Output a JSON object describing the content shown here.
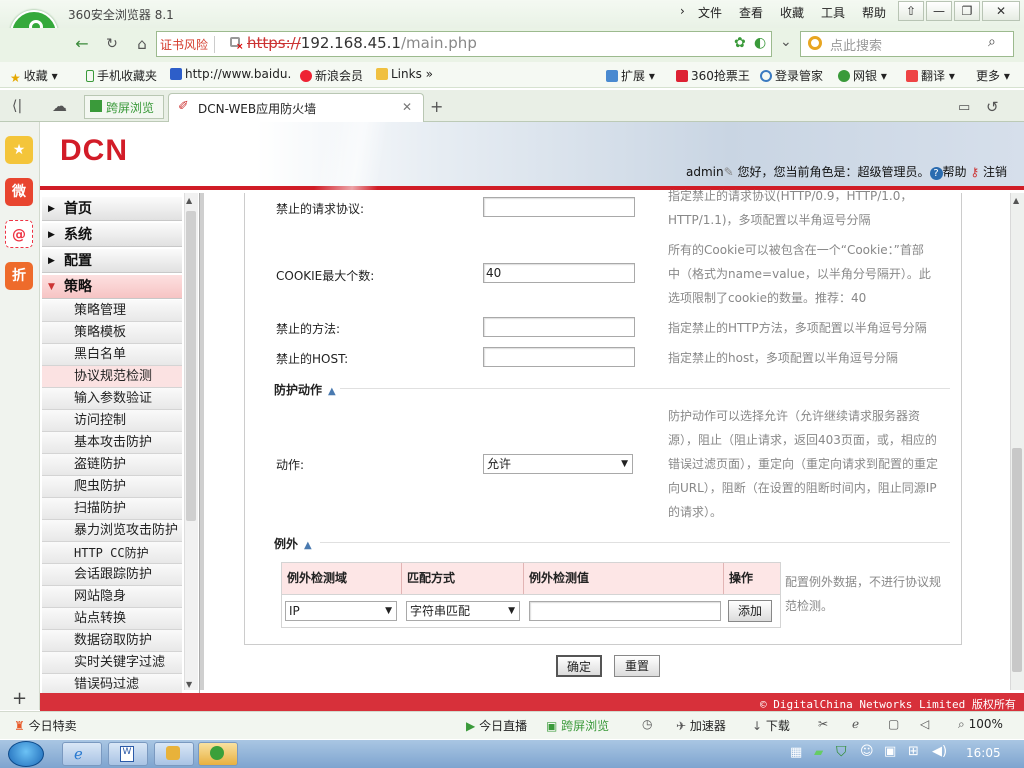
{
  "browser": {
    "title": "360安全浏览器 8.1",
    "menu": [
      "文件",
      "查看",
      "收藏",
      "工具",
      "帮助"
    ],
    "win_buttons": [
      "⇧",
      "—",
      "❐",
      "✕"
    ],
    "cert_warning": "证书风险",
    "url_scheme": "https://",
    "url_host": "192.168.45.1",
    "url_path": "/main.php",
    "search_placeholder": "点此搜索",
    "bookmarks": [
      "收藏",
      "手机收藏夹",
      "http://www.baidu.",
      "新浪会员",
      "Links",
      "扩展",
      "360抢票王",
      "登录管家",
      "网银",
      "翻译",
      "更多"
    ],
    "tabs": {
      "split": "跨屏浏览",
      "active": "DCN-WEB应用防火墙"
    },
    "side_icons": [
      "★",
      "微",
      "@",
      "折"
    ],
    "status": [
      "今日特卖",
      "今日直播",
      "跨屏浏览",
      "加速器",
      "下载",
      "100%"
    ],
    "clock": "16:05",
    "accent": "#35a93b"
  },
  "header": {
    "brand": "DCN",
    "user": "admin",
    "greeting": "您好，您当前角色是：超级管理员。",
    "help": "帮助",
    "logout": "注销",
    "color": "#d21c28"
  },
  "menu": {
    "top": [
      "首页",
      "系统",
      "配置",
      "策略"
    ],
    "sub": [
      "策略管理",
      "策略模板",
      "黑白名单",
      "协议规范检测",
      "输入参数验证",
      "访问控制",
      "基本攻击防护",
      "盗链防护",
      "爬虫防护",
      "扫描防护",
      "暴力浏览攻击防护",
      "HTTP CC防护",
      "会话跟踪防护",
      "网站隐身",
      "站点转换",
      "数据窃取防护",
      "实时关键字过滤",
      "错误码过滤"
    ]
  },
  "form": {
    "protocol_label": "禁止的请求协议:",
    "protocol_value": "",
    "protocol_desc": [
      "指定禁止的请求协议(HTTP/0.9，HTTP/1.0，",
      "HTTP/1.1)，多项配置以半角逗号分隔"
    ],
    "cookie_label": "COOKIE最大个数:",
    "cookie_value": "40",
    "cookie_desc": [
      "所有的Cookie可以被包含在一个“Cookie：”首部",
      "中（格式为name=value，以半角分号隔开）。此",
      "选项限制了cookie的数量。推荐：40"
    ],
    "method_label": "禁止的方法:",
    "method_value": "",
    "method_desc": "指定禁止的HTTP方法，多项配置以半角逗号分隔",
    "host_label": "禁止的HOST:",
    "host_value": "",
    "host_desc": "指定禁止的host，多项配置以半角逗号分隔",
    "action_section": "防护动作",
    "action_label": "动作:",
    "action_value": "允许",
    "action_desc": [
      "防护动作可以选择允许（允许继续请求服务器资",
      "源），阻止（阻止请求，返回403页面，或，相应的",
      "错误过滤页面），重定向（重定向请求到配置的重定",
      "向URL），阻断（在设置的阻断时间内，阻止同源IP",
      "的请求）。"
    ],
    "exception_section": "例外",
    "table_headers": [
      "例外检测域",
      "匹配方式",
      "例外检测值",
      "操作"
    ],
    "row_domain": "IP",
    "row_match": "字符串匹配",
    "row_value": "",
    "add_button": "添加",
    "exception_desc": [
      "配置例外数据，不进行协议规",
      "范检测。"
    ],
    "ok_button": "确定",
    "reset_button": "重置"
  },
  "footer": {
    "copyright": "© DigitalChina Networks Limited 版权所有"
  }
}
